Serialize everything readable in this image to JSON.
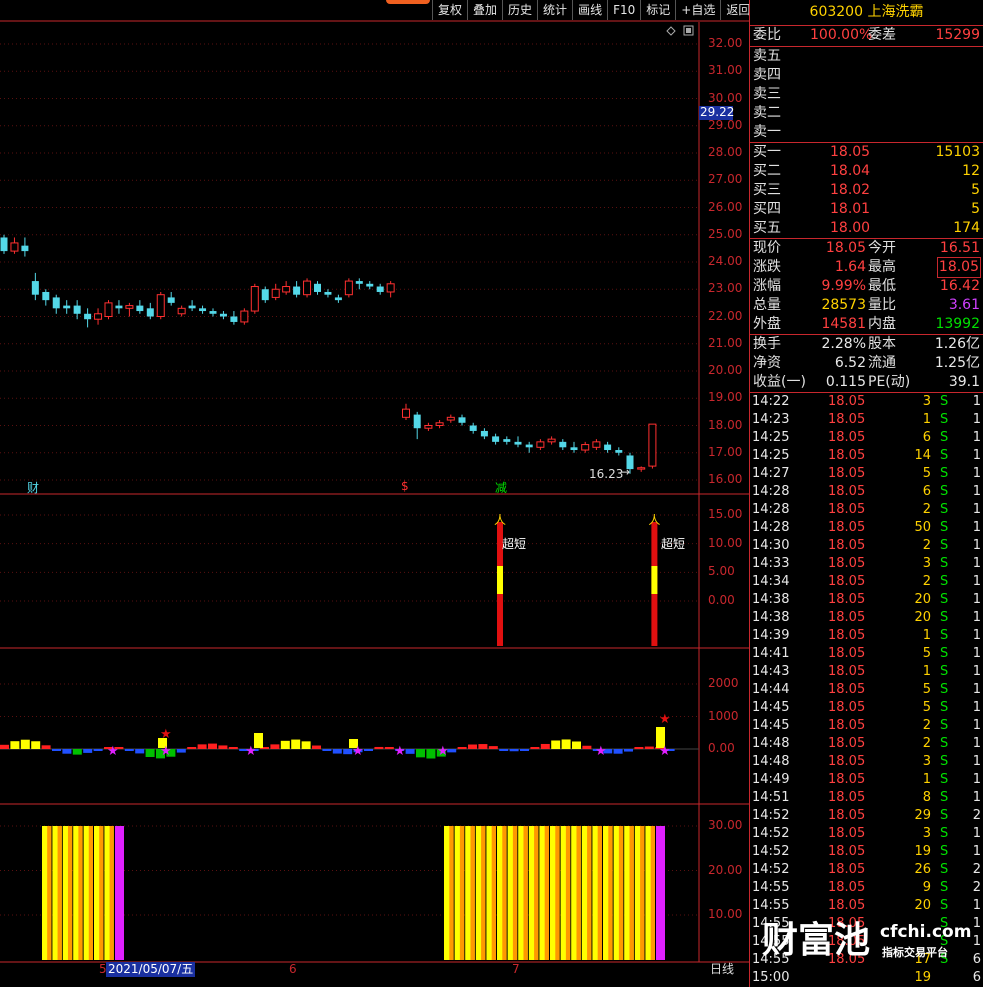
{
  "toolbar": {
    "buttons": [
      "复权",
      "叠加",
      "历史",
      "统计",
      "画线",
      "F10",
      "标记",
      "+自选",
      "返回"
    ]
  },
  "colors": {
    "up": "#ff3030",
    "down": "#54d8e8",
    "frame": "#c8272d",
    "yellow": "#ffff00",
    "magenta": "#e020ff"
  },
  "main_axis": {
    "ticks": [
      "32.00",
      "31.00",
      "30.00",
      "29.00",
      "28.00",
      "27.00",
      "26.00",
      "25.00",
      "24.00",
      "23.00",
      "22.00",
      "21.00",
      "20.00",
      "19.00",
      "18.00",
      "17.00",
      "16.00"
    ],
    "current_price_tag": "29.22"
  },
  "ind1_axis": {
    "ticks": [
      "15.00",
      "10.00",
      "5.00",
      "0.00"
    ]
  },
  "ind2_axis": {
    "ticks": [
      "2000",
      "1000",
      "0.00"
    ]
  },
  "ind3_axis": {
    "ticks": [
      "30.00",
      "20.00",
      "10.00"
    ]
  },
  "markers": {
    "cai": "财",
    "s": "$",
    "jian": "减",
    "low_label": "16.23",
    "low_arrow": "→",
    "chaoduan1": "超短",
    "chaoduan2": "超短"
  },
  "xaxis": {
    "mark5": "5",
    "date_box": "2021/05/07/五",
    "mark6": "6",
    "mark7": "7",
    "period": "日线"
  },
  "icons": [
    "diamond-icon",
    "window-restore-icon"
  ],
  "quote": {
    "code_name": "603200 上海洗霸",
    "weibi_label": "委比",
    "weibi_value": "100.00%",
    "weicha_label": "委差",
    "weicha_value": "15299",
    "sell": [
      {
        "label": "卖五"
      },
      {
        "label": "卖四"
      },
      {
        "label": "卖三"
      },
      {
        "label": "卖二"
      },
      {
        "label": "卖一"
      }
    ],
    "buy": [
      {
        "label": "买一",
        "price": "18.05",
        "vol": "15103"
      },
      {
        "label": "买二",
        "price": "18.04",
        "vol": "12"
      },
      {
        "label": "买三",
        "price": "18.02",
        "vol": "5"
      },
      {
        "label": "买四",
        "price": "18.01",
        "vol": "5"
      },
      {
        "label": "买五",
        "price": "18.00",
        "vol": "174"
      }
    ],
    "stats": [
      {
        "l1": "现价",
        "v1": "18.05",
        "c1": "red",
        "l2": "今开",
        "v2": "16.51",
        "c2": "red"
      },
      {
        "l1": "涨跌",
        "v1": "1.64",
        "c1": "red",
        "l2": "最高",
        "v2": "18.05",
        "c2": "red",
        "box2": true
      },
      {
        "l1": "涨幅",
        "v1": "9.99%",
        "c1": "red",
        "l2": "最低",
        "v2": "16.42",
        "c2": "red"
      },
      {
        "l1": "总量",
        "v1": "28573",
        "c1": "yel",
        "l2": "量比",
        "v2": "3.61",
        "c2": "pur"
      },
      {
        "l1": "外盘",
        "v1": "14581",
        "c1": "red",
        "l2": "内盘",
        "v2": "13992",
        "c2": "grn"
      }
    ],
    "stats2": [
      {
        "l1": "换手",
        "v1": "2.28%",
        "l2": "股本",
        "v2": "1.26亿"
      },
      {
        "l1": "净资",
        "v1": "6.52",
        "l2": "流通",
        "v2": "1.25亿"
      },
      {
        "l1": "收益(一)",
        "v1": "0.115",
        "l2": "PE(动)",
        "v2": "39.1"
      }
    ]
  },
  "ticks": [
    {
      "t": "14:22",
      "p": "18.05",
      "v": "3",
      "f": "S",
      "n": "1"
    },
    {
      "t": "14:23",
      "p": "18.05",
      "v": "1",
      "f": "S",
      "n": "1"
    },
    {
      "t": "14:25",
      "p": "18.05",
      "v": "6",
      "f": "S",
      "n": "1"
    },
    {
      "t": "14:25",
      "p": "18.05",
      "v": "14",
      "f": "S",
      "n": "1"
    },
    {
      "t": "14:27",
      "p": "18.05",
      "v": "5",
      "f": "S",
      "n": "1"
    },
    {
      "t": "14:28",
      "p": "18.05",
      "v": "6",
      "f": "S",
      "n": "1"
    },
    {
      "t": "14:28",
      "p": "18.05",
      "v": "2",
      "f": "S",
      "n": "1"
    },
    {
      "t": "14:28",
      "p": "18.05",
      "v": "50",
      "f": "S",
      "n": "1"
    },
    {
      "t": "14:30",
      "p": "18.05",
      "v": "2",
      "f": "S",
      "n": "1"
    },
    {
      "t": "14:33",
      "p": "18.05",
      "v": "3",
      "f": "S",
      "n": "1"
    },
    {
      "t": "14:34",
      "p": "18.05",
      "v": "2",
      "f": "S",
      "n": "1"
    },
    {
      "t": "14:38",
      "p": "18.05",
      "v": "20",
      "f": "S",
      "n": "1"
    },
    {
      "t": "14:38",
      "p": "18.05",
      "v": "20",
      "f": "S",
      "n": "1"
    },
    {
      "t": "14:39",
      "p": "18.05",
      "v": "1",
      "f": "S",
      "n": "1"
    },
    {
      "t": "14:41",
      "p": "18.05",
      "v": "5",
      "f": "S",
      "n": "1"
    },
    {
      "t": "14:43",
      "p": "18.05",
      "v": "1",
      "f": "S",
      "n": "1"
    },
    {
      "t": "14:44",
      "p": "18.05",
      "v": "5",
      "f": "S",
      "n": "1"
    },
    {
      "t": "14:45",
      "p": "18.05",
      "v": "5",
      "f": "S",
      "n": "1"
    },
    {
      "t": "14:45",
      "p": "18.05",
      "v": "2",
      "f": "S",
      "n": "1"
    },
    {
      "t": "14:48",
      "p": "18.05",
      "v": "2",
      "f": "S",
      "n": "1"
    },
    {
      "t": "14:48",
      "p": "18.05",
      "v": "3",
      "f": "S",
      "n": "1"
    },
    {
      "t": "14:49",
      "p": "18.05",
      "v": "1",
      "f": "S",
      "n": "1"
    },
    {
      "t": "14:51",
      "p": "18.05",
      "v": "8",
      "f": "S",
      "n": "1"
    },
    {
      "t": "14:52",
      "p": "18.05",
      "v": "29",
      "f": "S",
      "n": "2"
    },
    {
      "t": "14:52",
      "p": "18.05",
      "v": "3",
      "f": "S",
      "n": "1"
    },
    {
      "t": "14:52",
      "p": "18.05",
      "v": "19",
      "f": "S",
      "n": "1"
    },
    {
      "t": "14:52",
      "p": "18.05",
      "v": "26",
      "f": "S",
      "n": "2"
    },
    {
      "t": "14:55",
      "p": "18.05",
      "v": "9",
      "f": "S",
      "n": "2"
    },
    {
      "t": "14:55",
      "p": "18.05",
      "v": "20",
      "f": "S",
      "n": "1"
    },
    {
      "t": "14:55",
      "p": "18.05",
      "v": "",
      "f": "S",
      "n": "1"
    },
    {
      "t": "14:55",
      "p": "18.05",
      "v": "",
      "f": "S",
      "n": "1"
    },
    {
      "t": "14:55",
      "p": "18.05",
      "v": "17",
      "f": "S",
      "n": "6"
    },
    {
      "t": "15:00",
      "p": "",
      "v": "19",
      "f": "",
      "n": "6"
    }
  ],
  "watermark": {
    "big": "财富池",
    "url": "cfchi.com",
    "sub": "指标交易平台"
  },
  "chart_data": {
    "type": "candlestick",
    "price_axis": {
      "min": 16.0,
      "max": 32.0
    },
    "candles": [
      {
        "o": 24.9,
        "c": 24.4,
        "h": 25.0,
        "l": 24.3
      },
      {
        "o": 24.4,
        "c": 24.7,
        "h": 24.9,
        "l": 24.3
      },
      {
        "o": 24.6,
        "c": 24.4,
        "h": 24.9,
        "l": 24.2
      },
      {
        "o": 23.3,
        "c": 22.8,
        "h": 23.6,
        "l": 22.6
      },
      {
        "o": 22.9,
        "c": 22.6,
        "h": 23.0,
        "l": 22.4
      },
      {
        "o": 22.7,
        "c": 22.3,
        "h": 22.8,
        "l": 22.1
      },
      {
        "o": 22.4,
        "c": 22.3,
        "h": 22.6,
        "l": 22.1
      },
      {
        "o": 22.4,
        "c": 22.1,
        "h": 22.6,
        "l": 21.9
      },
      {
        "o": 22.1,
        "c": 21.9,
        "h": 22.3,
        "l": 21.6
      },
      {
        "o": 21.9,
        "c": 22.1,
        "h": 22.3,
        "l": 21.7
      },
      {
        "o": 22.0,
        "c": 22.5,
        "h": 22.6,
        "l": 21.9
      },
      {
        "o": 22.4,
        "c": 22.3,
        "h": 22.6,
        "l": 22.1
      },
      {
        "o": 22.3,
        "c": 22.4,
        "h": 22.5,
        "l": 22.0
      },
      {
        "o": 22.4,
        "c": 22.2,
        "h": 22.6,
        "l": 22.1
      },
      {
        "o": 22.3,
        "c": 22.0,
        "h": 22.5,
        "l": 21.9
      },
      {
        "o": 22.0,
        "c": 22.8,
        "h": 22.9,
        "l": 21.9
      },
      {
        "o": 22.7,
        "c": 22.5,
        "h": 22.9,
        "l": 22.4
      },
      {
        "o": 22.1,
        "c": 22.3,
        "h": 22.4,
        "l": 22.0
      },
      {
        "o": 22.4,
        "c": 22.3,
        "h": 22.6,
        "l": 22.2
      },
      {
        "o": 22.3,
        "c": 22.2,
        "h": 22.4,
        "l": 22.1
      },
      {
        "o": 22.2,
        "c": 22.1,
        "h": 22.3,
        "l": 22.0
      },
      {
        "o": 22.1,
        "c": 22.0,
        "h": 22.2,
        "l": 21.9
      },
      {
        "o": 22.0,
        "c": 21.8,
        "h": 22.2,
        "l": 21.7
      },
      {
        "o": 21.8,
        "c": 22.2,
        "h": 22.3,
        "l": 21.7
      },
      {
        "o": 22.2,
        "c": 23.1,
        "h": 23.2,
        "l": 22.1
      },
      {
        "o": 23.0,
        "c": 22.6,
        "h": 23.1,
        "l": 22.5
      },
      {
        "o": 22.7,
        "c": 23.0,
        "h": 23.2,
        "l": 22.6
      },
      {
        "o": 22.9,
        "c": 23.1,
        "h": 23.3,
        "l": 22.8
      },
      {
        "o": 23.1,
        "c": 22.8,
        "h": 23.3,
        "l": 22.7
      },
      {
        "o": 22.8,
        "c": 23.3,
        "h": 23.4,
        "l": 22.7
      },
      {
        "o": 23.2,
        "c": 22.9,
        "h": 23.3,
        "l": 22.8
      },
      {
        "o": 22.9,
        "c": 22.8,
        "h": 23.0,
        "l": 22.7
      },
      {
        "o": 22.7,
        "c": 22.6,
        "h": 22.8,
        "l": 22.5
      },
      {
        "o": 22.8,
        "c": 23.3,
        "h": 23.4,
        "l": 22.7
      },
      {
        "o": 23.3,
        "c": 23.2,
        "h": 23.4,
        "l": 23.0
      },
      {
        "o": 23.2,
        "c": 23.1,
        "h": 23.3,
        "l": 23.0
      },
      {
        "o": 23.1,
        "c": 22.9,
        "h": 23.2,
        "l": 22.8
      },
      {
        "o": 22.9,
        "c": 23.2,
        "h": 23.3,
        "l": 22.7
      },
      {
        "o": 18.3,
        "c": 18.6,
        "h": 18.8,
        "l": 18.2
      },
      {
        "o": 18.4,
        "c": 17.9,
        "h": 18.5,
        "l": 17.5
      },
      {
        "o": 17.9,
        "c": 18.0,
        "h": 18.1,
        "l": 17.8
      },
      {
        "o": 18.0,
        "c": 18.1,
        "h": 18.2,
        "l": 17.9
      },
      {
        "o": 18.2,
        "c": 18.3,
        "h": 18.4,
        "l": 18.1
      },
      {
        "o": 18.3,
        "c": 18.1,
        "h": 18.4,
        "l": 18.0
      },
      {
        "o": 18.0,
        "c": 17.8,
        "h": 18.1,
        "l": 17.7
      },
      {
        "o": 17.8,
        "c": 17.6,
        "h": 17.9,
        "l": 17.5
      },
      {
        "o": 17.6,
        "c": 17.4,
        "h": 17.7,
        "l": 17.3
      },
      {
        "o": 17.5,
        "c": 17.4,
        "h": 17.6,
        "l": 17.3
      },
      {
        "o": 17.4,
        "c": 17.3,
        "h": 17.6,
        "l": 17.2
      },
      {
        "o": 17.3,
        "c": 17.2,
        "h": 17.4,
        "l": 17.0
      },
      {
        "o": 17.2,
        "c": 17.4,
        "h": 17.5,
        "l": 17.1
      },
      {
        "o": 17.4,
        "c": 17.5,
        "h": 17.6,
        "l": 17.3
      },
      {
        "o": 17.4,
        "c": 17.2,
        "h": 17.5,
        "l": 17.1
      },
      {
        "o": 17.2,
        "c": 17.1,
        "h": 17.4,
        "l": 17.0
      },
      {
        "o": 17.1,
        "c": 17.3,
        "h": 17.4,
        "l": 17.0
      },
      {
        "o": 17.2,
        "c": 17.4,
        "h": 17.5,
        "l": 17.1
      },
      {
        "o": 17.3,
        "c": 17.1,
        "h": 17.4,
        "l": 17.0
      },
      {
        "o": 17.1,
        "c": 17.0,
        "h": 17.2,
        "l": 16.9
      },
      {
        "o": 16.9,
        "c": 16.4,
        "h": 17.0,
        "l": 16.23
      },
      {
        "o": 16.4,
        "c": 16.45,
        "h": 16.5,
        "l": 16.3
      },
      {
        "o": 16.51,
        "c": 18.05,
        "h": 18.05,
        "l": 16.42
      }
    ],
    "ind1": {
      "axis": {
        "min": 0,
        "max": 15
      },
      "signal_bars": [
        {
          "index": 38,
          "value": 15
        },
        {
          "index": 60,
          "value": 15
        }
      ]
    },
    "ind2": {
      "axis": {
        "min": 0,
        "max": 2000
      }
    },
    "ind3": {
      "axis": {
        "min": 0,
        "max": 30
      }
    }
  }
}
